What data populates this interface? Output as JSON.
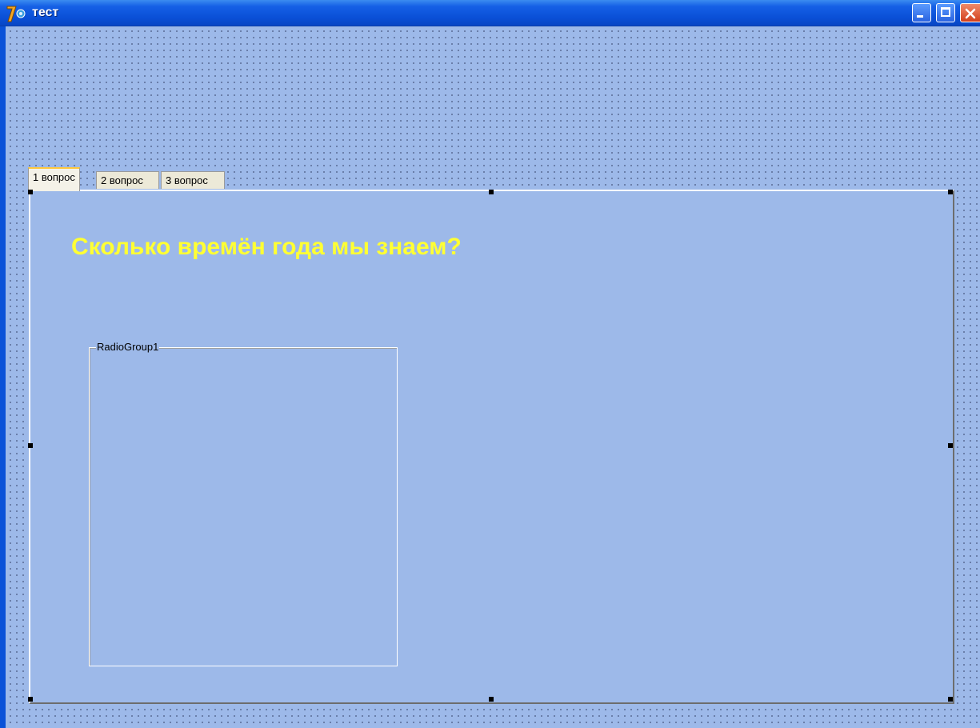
{
  "window": {
    "title": "тест",
    "icon": "delphi-icon"
  },
  "title_buttons": {
    "minimize": "minimize-icon",
    "maximize": "maximize-icon",
    "close": "close-icon"
  },
  "tabs": [
    {
      "label": "1 вопрос",
      "active": true
    },
    {
      "label": "2 вопрос",
      "active": false
    },
    {
      "label": "3 вопрос",
      "active": false
    }
  ],
  "page": {
    "question": "Сколько времён года мы знаем?",
    "radiogroup_caption": "RadioGroup1"
  },
  "colors": {
    "form_background": "#9db9e9",
    "question_text": "#ffff33",
    "titlebar": "#0a52d8"
  }
}
